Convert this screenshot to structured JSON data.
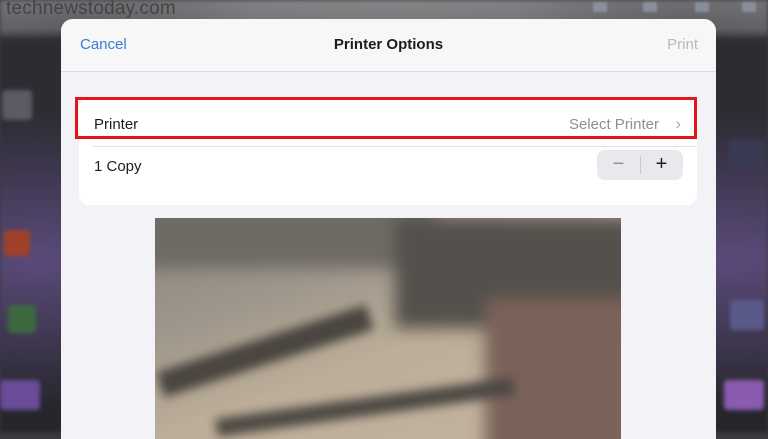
{
  "watermark": "technewstoday.com",
  "navbar": {
    "cancel_label": "Cancel",
    "title": "Printer Options",
    "print_label": "Print"
  },
  "printer_row": {
    "label": "Printer",
    "value": "Select Printer",
    "chevron": "›"
  },
  "copies_row": {
    "label": "1 Copy",
    "minus": "−",
    "plus": "+"
  },
  "colors": {
    "accent": "#3a7bd5",
    "highlight": "#e0161a",
    "disabled": "#b8b8bd"
  },
  "icons": {
    "chevron": "chevron-right-icon",
    "minus": "minus-icon",
    "plus": "plus-icon"
  }
}
